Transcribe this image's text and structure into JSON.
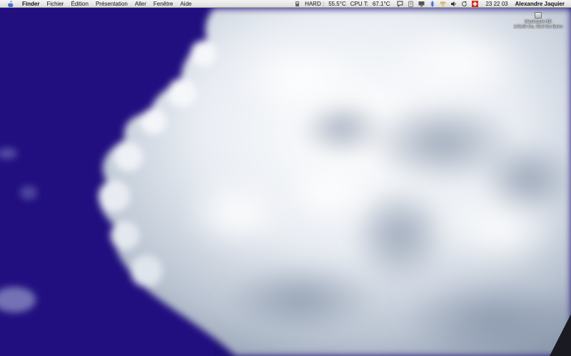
{
  "menubar": {
    "apple_icon": "apple-icon",
    "app_name": "Finder",
    "menus": [
      "Fichier",
      "Édition",
      "Présentation",
      "Aller",
      "Fenêtre",
      "Aide"
    ],
    "hard_label": "HARD :",
    "hard_temp": "55.5°C",
    "cpu_label": "CPU T:",
    "cpu_temp": "67.1°C",
    "clock": "23 22 03",
    "user_name": "Alexandre Jaquier"
  },
  "desktop": {
    "disk_name": "Macintosh HD",
    "disk_info": "149,05 Go, 50,9 Go libres"
  },
  "colors": {
    "sky": "#1e0e78",
    "cloud_light": "#f2f4f8",
    "cloud_shadow": "#8e9cb0",
    "menubar": "#e8e8e8"
  }
}
